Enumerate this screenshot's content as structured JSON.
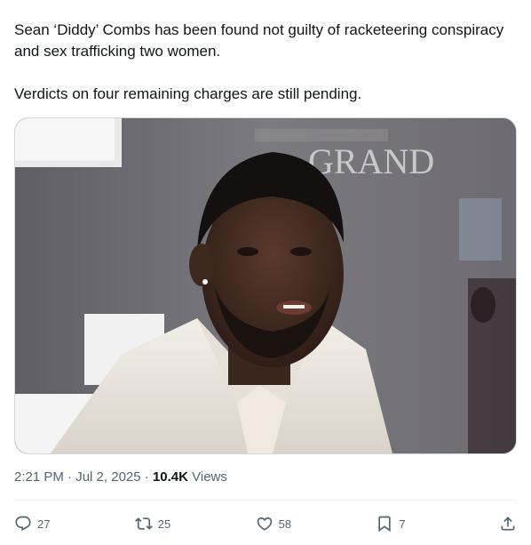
{
  "tweet": {
    "text_line1": "Sean ‘Diddy’ Combs has been found not guilty of racketeering conspiracy and sex trafficking two women.",
    "text_line2": "Verdicts on four remaining charges are still pending."
  },
  "media": {
    "backdrop_text": "GRAND"
  },
  "meta": {
    "time": "2:21 PM",
    "separator1": " · ",
    "date": "Jul 2, 2025",
    "separator2": " · ",
    "views_count": "10.4K",
    "views_label": " Views"
  },
  "actions": {
    "reply_count": "27",
    "repost_count": "25",
    "like_count": "58",
    "bookmark_count": "7"
  },
  "icons": [
    "reply-icon",
    "repost-icon",
    "like-icon",
    "bookmark-icon",
    "share-icon"
  ]
}
